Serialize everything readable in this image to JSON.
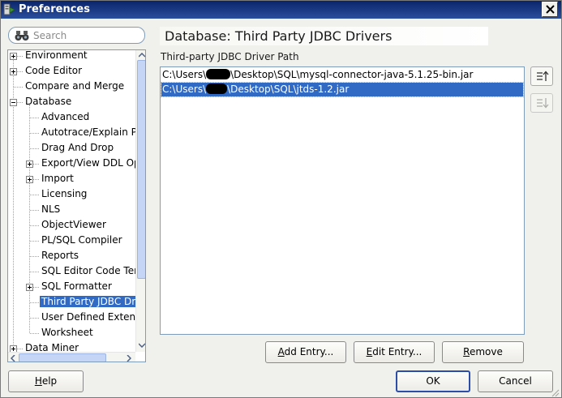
{
  "window": {
    "title": "Preferences"
  },
  "search": {
    "placeholder": "Search"
  },
  "tree": {
    "items": [
      {
        "label": "Environment",
        "level": 0,
        "expander": "plus"
      },
      {
        "label": "Code Editor",
        "level": 0,
        "expander": "plus"
      },
      {
        "label": "Compare and Merge",
        "level": 0,
        "expander": "none"
      },
      {
        "label": "Database",
        "level": 0,
        "expander": "minus"
      },
      {
        "label": "Advanced",
        "level": 1,
        "expander": "none"
      },
      {
        "label": "Autotrace/Explain Pl",
        "level": 1,
        "expander": "none"
      },
      {
        "label": "Drag And Drop",
        "level": 1,
        "expander": "none"
      },
      {
        "label": "Export/View DDL Op",
        "level": 1,
        "expander": "plus"
      },
      {
        "label": "Import",
        "level": 1,
        "expander": "plus"
      },
      {
        "label": "Licensing",
        "level": 1,
        "expander": "none"
      },
      {
        "label": "NLS",
        "level": 1,
        "expander": "none"
      },
      {
        "label": "ObjectViewer",
        "level": 1,
        "expander": "none"
      },
      {
        "label": "PL/SQL Compiler",
        "level": 1,
        "expander": "none"
      },
      {
        "label": "Reports",
        "level": 1,
        "expander": "none"
      },
      {
        "label": "SQL Editor Code Ter",
        "level": 1,
        "expander": "none"
      },
      {
        "label": "SQL Formatter",
        "level": 1,
        "expander": "plus"
      },
      {
        "label": "Third Party JDBC Dri",
        "level": 1,
        "expander": "none",
        "selected": true
      },
      {
        "label": "User Defined Extens",
        "level": 1,
        "expander": "none"
      },
      {
        "label": "Worksheet",
        "level": 1,
        "expander": "none"
      },
      {
        "label": "Data Miner",
        "level": 0,
        "expander": "plus"
      }
    ]
  },
  "content": {
    "title": "Database: Third Party JDBC Drivers",
    "section_label": "Third-party JDBC Driver Path",
    "paths": [
      {
        "prefix": "C:\\Users\\",
        "suffix": "\\Desktop\\SQL\\mysql-connector-java-5.1.25-bin.jar",
        "selected": false
      },
      {
        "prefix": "C:\\Users\\",
        "suffix": "\\Desktop\\SQL\\jtds-1.2.jar",
        "selected": true
      }
    ],
    "move_up_icon": "move-up-icon",
    "move_down_icon": "move-down-icon"
  },
  "buttons": {
    "add_entry": {
      "mnemonic": "A",
      "rest": "dd Entry..."
    },
    "edit_entry": {
      "mnemonic": "E",
      "rest": "dit Entry..."
    },
    "remove": {
      "mnemonic": "R",
      "rest": "emove"
    },
    "help": {
      "mnemonic": "H",
      "rest": "elp"
    },
    "ok": "OK",
    "cancel": "Cancel"
  },
  "colors": {
    "selection": "#316ac5",
    "title_bar": "#0a246a",
    "default_button_border": "#2c4ea6"
  }
}
